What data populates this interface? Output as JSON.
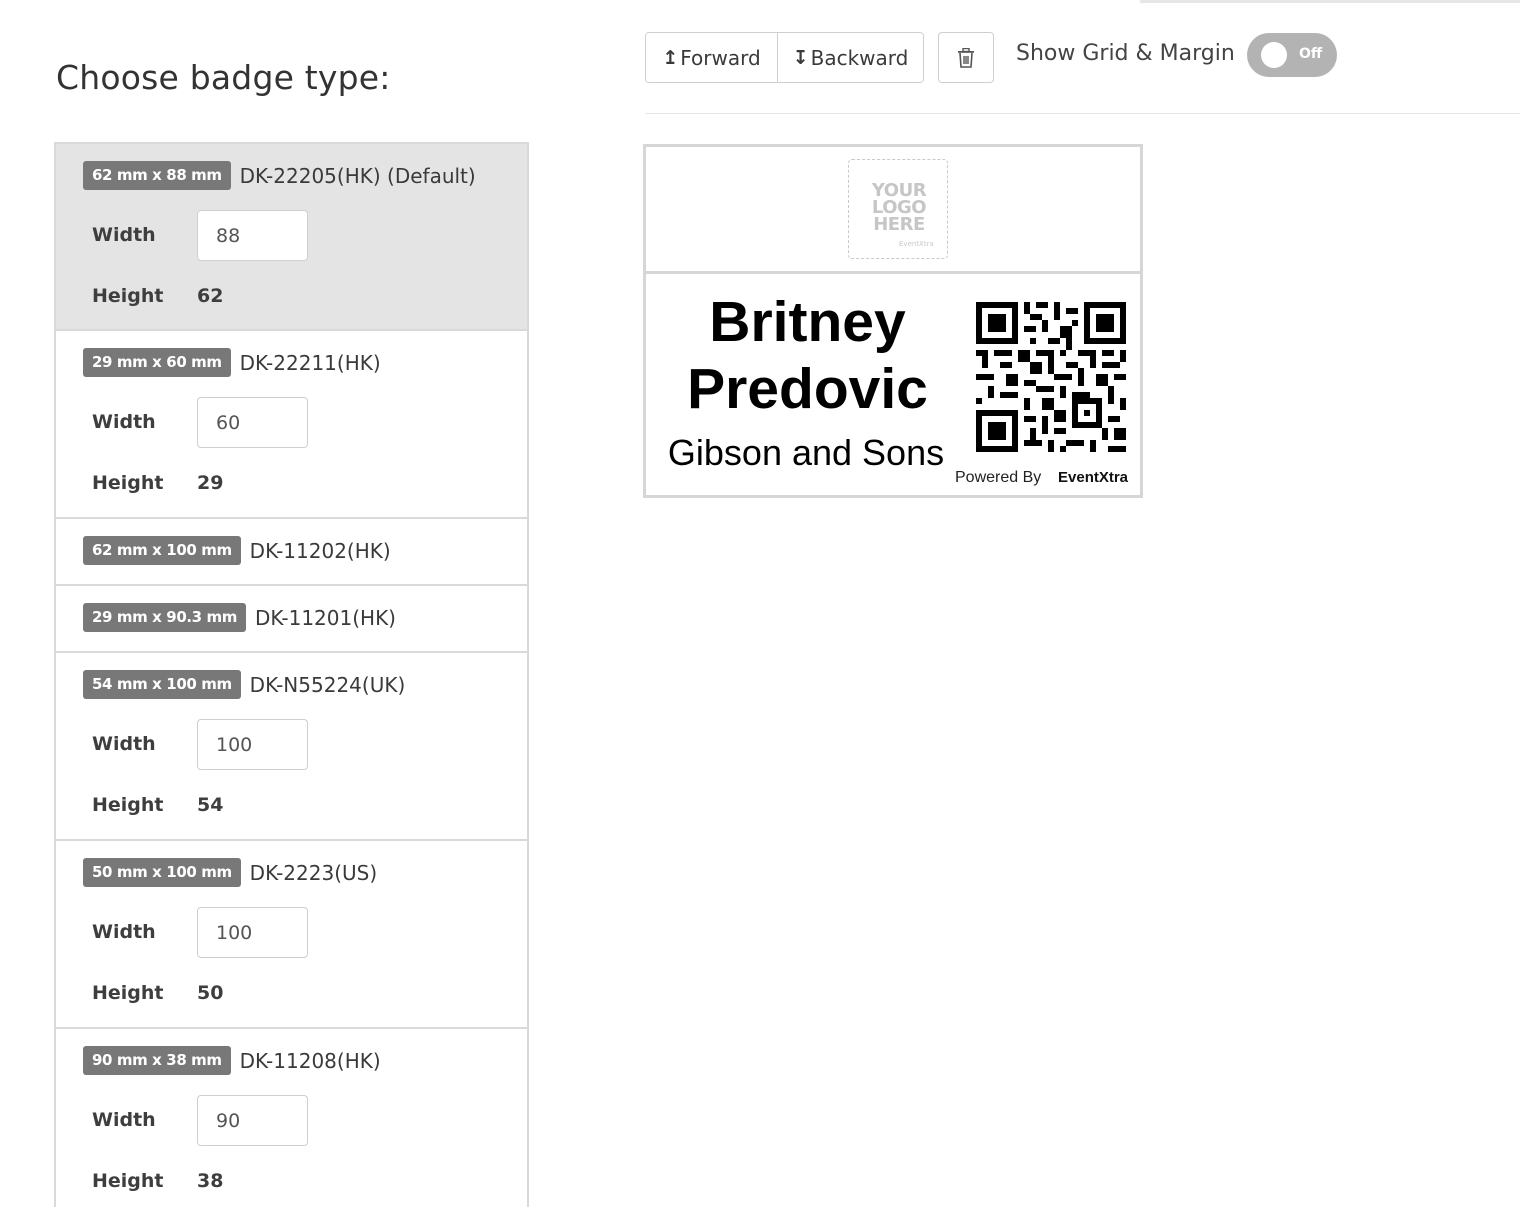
{
  "panel": {
    "title": "Choose badge type:",
    "width_label": "Width",
    "height_label": "Height"
  },
  "badge_types": [
    {
      "size": "62 mm x 88 mm",
      "name": "DK-22205(HK) (Default)",
      "width": "88",
      "height": "62",
      "selected": true
    },
    {
      "size": "29 mm x 60 mm",
      "name": "DK-22211(HK)",
      "width": "60",
      "height": "29"
    },
    {
      "size": "62 mm x 100 mm",
      "name": "DK-11202(HK)"
    },
    {
      "size": "29 mm x 90.3 mm",
      "name": "DK-11201(HK)"
    },
    {
      "size": "54 mm x 100 mm",
      "name": "DK-N55224(UK)",
      "width": "100",
      "height": "54"
    },
    {
      "size": "50 mm x 100 mm",
      "name": "DK-2223(US)",
      "width": "100",
      "height": "50"
    },
    {
      "size": "90 mm x 38 mm",
      "name": "DK-11208(HK)",
      "width": "90",
      "height": "38"
    }
  ],
  "toolbar": {
    "forward_icon": "↥",
    "forward_label": "Forward",
    "backward_icon": "↧",
    "backward_label": "Backward",
    "delete_icon": "trash-icon",
    "grid_label": "Show Grid & Margin",
    "toggle_state": "Off"
  },
  "badge_preview": {
    "logo_lines": [
      "YOUR",
      "LOGO",
      "HERE"
    ],
    "logo_brand": "EventXtra",
    "first_name": "Britney",
    "last_name": "Predovic",
    "company": "Gibson and Sons",
    "powered_by": "Powered By",
    "brand": "EventXtra"
  }
}
